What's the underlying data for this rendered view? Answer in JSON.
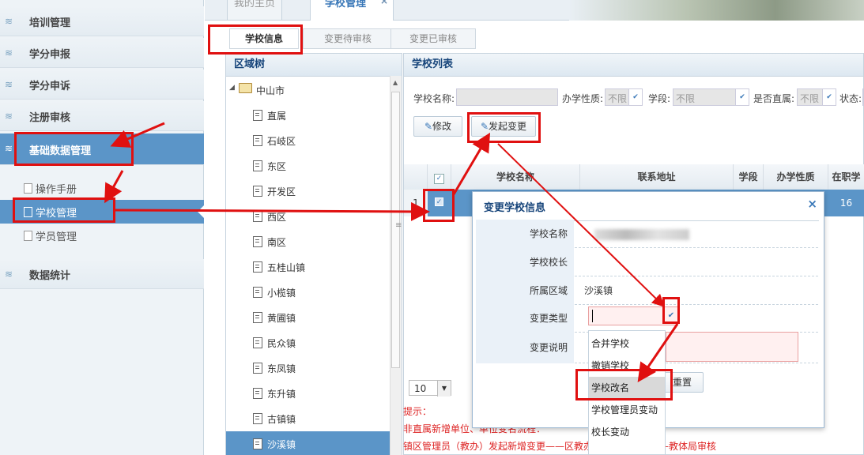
{
  "sidebar": {
    "menus": [
      {
        "label": "培训管理"
      },
      {
        "label": "学分申报"
      },
      {
        "label": "学分申诉"
      },
      {
        "label": "注册审核"
      },
      {
        "label": "基础数据管理"
      },
      {
        "label": "数据统计"
      }
    ],
    "submenus": [
      {
        "label": "操作手册"
      },
      {
        "label": "学校管理"
      },
      {
        "label": "学员管理"
      }
    ]
  },
  "top_tabs": {
    "home": "我的主页",
    "current": "学校管理",
    "close": "×"
  },
  "inner_tabs": [
    "学校信息",
    "变更待审核",
    "变更已审核"
  ],
  "tree": {
    "title": "区域树",
    "root": "中山市",
    "nodes": [
      "直属",
      "石岐区",
      "东区",
      "开发区",
      "西区",
      "南区",
      "五桂山镇",
      "小榄镇",
      "黄圃镇",
      "民众镇",
      "东凤镇",
      "东升镇",
      "古镇镇",
      "沙溪镇"
    ]
  },
  "list": {
    "title": "学校列表",
    "filters": {
      "name_label": "学校名称:",
      "nature_label": "办学性质:",
      "nature_value": "不限",
      "stage_label": "学段:",
      "stage_value": "不限",
      "direct_label": "是否直属:",
      "direct_value": "不限",
      "status_label": "状态:"
    },
    "buttons": {
      "edit": "修改",
      "change": "发起变更"
    },
    "columns": [
      "学校名称",
      "联系地址",
      "学段",
      "办学性质",
      "在职学"
    ],
    "row": {
      "index": "1",
      "count": "16"
    },
    "page_size": "10"
  },
  "dialog": {
    "title": "变更学校信息",
    "close": "×",
    "fields": [
      {
        "label": "学校名称",
        "value": ""
      },
      {
        "label": "学校校长",
        "value": ""
      },
      {
        "label": "所属区域",
        "value": "沙溪镇"
      },
      {
        "label": "变更类型",
        "value": ""
      },
      {
        "label": "变更说明",
        "value": ""
      }
    ],
    "reset_button": "重置"
  },
  "dropdown_options": [
    "合并学校",
    "撤销学校",
    "学校改名",
    "学校管理员变动",
    "校长变动"
  ],
  "tips": {
    "title": "提示：",
    "line1": "非直属新增单位、单位变名流程：",
    "line2": "镇区管理员（教办）发起新增变更——区教办审核——学校——教体局审核"
  },
  "colors": {
    "accent": "#5b95c8",
    "annotation": "#e01010",
    "header_text": "#16447a"
  }
}
